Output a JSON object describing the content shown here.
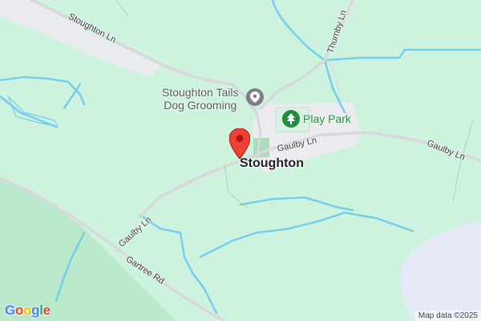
{
  "map": {
    "place": {
      "name": "Stoughton"
    },
    "roads": {
      "stoughton_ln": "Stoughton Ln",
      "thurnby_ln": "Thurnby Ln",
      "gaulby_ln_center": "Gaulby Ln",
      "gaulby_ln_east": "Gaulby Ln",
      "gaulby_ln_southwest": "Gaulby Ln",
      "gartree_rd": "Gartree Rd"
    },
    "pois": {
      "dog_grooming": {
        "name_line1": "Stoughton Tails",
        "name_line2": "Dog Grooming",
        "icon": "location-pin-icon"
      },
      "play_park": {
        "name": "Play Park",
        "icon": "tree-icon"
      }
    },
    "marker": {
      "icon": "red-map-pin-icon"
    },
    "footer": {
      "logo": "Google",
      "attribution": "Map data ©2025"
    },
    "colors": {
      "land": "#cdf3df",
      "park": "#b9e8cb",
      "water": "#74ceec",
      "roads": "#d8d8dc",
      "settlement": "#ececf0",
      "marker": "#ea4335",
      "lake": "#e6e9f7"
    }
  }
}
